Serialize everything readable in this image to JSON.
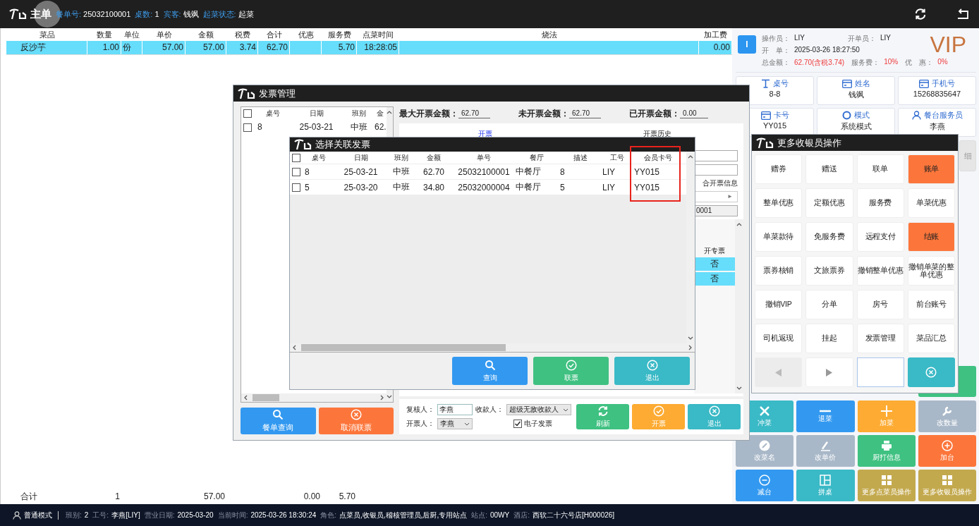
{
  "topbar": {
    "title": "主单",
    "fields": [
      {
        "label": "餐单号:",
        "value": "25032100001"
      },
      {
        "label": "桌数:",
        "value": "1"
      },
      {
        "label": "宾客:",
        "value": "钱飒"
      },
      {
        "label": "起菜状态:",
        "value": "起菜"
      }
    ]
  },
  "order_table": {
    "columns": [
      "菜品",
      "数量",
      "单位",
      "单价",
      "金额",
      "税费",
      "合计",
      "优惠",
      "服务费",
      "点菜时间",
      "烧法",
      "加工费"
    ],
    "rows": [
      {
        "selected": true,
        "cells": [
          "反沙芋",
          "1.00",
          "份",
          "57.00",
          "57.00",
          "3.74",
          "62.70",
          "",
          "5.70",
          "18:28:05",
          "",
          "0.00"
        ]
      }
    ],
    "totals": {
      "label": "合计",
      "quantity": "1",
      "amount": "57.00",
      "discount": "0.00",
      "service_fee": "5.70"
    }
  },
  "operator_info": {
    "badge": "I",
    "rows": [
      [
        {
          "label": "操作员：",
          "value": "LIY",
          "kind": "plain"
        },
        {
          "label": "开单员：",
          "value": "LIY",
          "kind": "plain"
        }
      ],
      [
        {
          "label": "开　单：",
          "value": "2025-03-26 18:27:50",
          "kind": "plain"
        }
      ],
      [
        {
          "label": "总金额：",
          "value": "62.70(含税3.74)",
          "kind": "alert"
        },
        {
          "label": "服务费：",
          "value": "10%",
          "kind": "alert"
        },
        {
          "label": "优　惠：",
          "value": "0%",
          "kind": "alert"
        }
      ]
    ],
    "vip": "VIP"
  },
  "info_cards": [
    {
      "kind": "table",
      "label": "桌号",
      "value": "8-8"
    },
    {
      "kind": "card",
      "label": "姓名",
      "value": "钱飒"
    },
    {
      "kind": "card",
      "label": "手机号",
      "value": "15268835647"
    },
    {
      "kind": "card",
      "label": "卡号",
      "value": "YY015"
    },
    {
      "kind": "ring",
      "label": "模式",
      "value": "系统模式"
    },
    {
      "kind": "person",
      "label": "餐台服务员",
      "value": "李燕"
    }
  ],
  "detail_button": {
    "label": "细"
  },
  "action_buttons": [
    {
      "label": "冲菜",
      "kind": "cross",
      "color": "#3ab9c6"
    },
    {
      "label": "退菜",
      "kind": "minus",
      "color": "#3399f0"
    },
    {
      "label": "加菜",
      "kind": "plus",
      "color": "#fdab32"
    },
    {
      "label": "改数量",
      "kind": "wrench",
      "color": "#a9b8c8"
    },
    {
      "label": "改菜名",
      "kind": "pencil",
      "color": "#a9b8c8"
    },
    {
      "label": "改单价",
      "kind": "pen",
      "color": "#a9b8c8"
    },
    {
      "label": "厨打信息",
      "kind": "printer",
      "color": "#3fc181"
    },
    {
      "label": "加台",
      "kind": "plus-circle",
      "color": "#fc763b"
    },
    {
      "label": "减台",
      "kind": "minus-circle",
      "color": "#3399f0"
    },
    {
      "label": "拼桌",
      "kind": "layout",
      "color": "#3ab9c6"
    },
    {
      "label": "更多点菜员操作",
      "kind": "grid",
      "color": "#c3a94e"
    },
    {
      "label": "更多收银员操作",
      "kind": "grid",
      "color": "#c3a94e"
    }
  ],
  "invoice_dialog": {
    "title": "发票管理",
    "bill_list": {
      "header_checked": false,
      "columns": [
        "桌号",
        "日期",
        "班别",
        "金"
      ],
      "rows": [
        {
          "checked": false,
          "cells": [
            "8",
            "25-03-21",
            "中班",
            "62."
          ]
        }
      ]
    },
    "buttons": [
      {
        "label": "餐单查询",
        "kind": "search",
        "color": "#3399f0"
      },
      {
        "label": "取消联票",
        "kind": "cancel",
        "color": "#fc763b"
      }
    ],
    "amounts": [
      {
        "label": "最大开票金额：",
        "value": "62.70"
      },
      {
        "label": "未开票金额：",
        "value": "62.70"
      },
      {
        "label": "已开票金额：",
        "value": "0.00"
      }
    ],
    "tabs": [
      {
        "label": "开票",
        "selected": true
      },
      {
        "label": "开票历史",
        "selected": false
      }
    ],
    "info_label": "合开票信息",
    "dropdown_arrow": "►",
    "code_value": "0001",
    "special_table": {
      "column": "开专票",
      "rows": [
        "否",
        "否"
      ]
    },
    "form": {
      "reviewer": {
        "label": "复核人：",
        "value": "李燕"
      },
      "payee": {
        "label": "收款人：",
        "value": "超级无敌收款人"
      },
      "issuer": {
        "label": "开票人：",
        "value": "李燕"
      },
      "e_invoice": {
        "label": "电子发票",
        "checked": true
      }
    },
    "actions": [
      {
        "label": "刷新",
        "kind": "refresh",
        "color": "#3fc181"
      },
      {
        "label": "开票",
        "kind": "check",
        "color": "#fdab32"
      },
      {
        "label": "退出",
        "kind": "cancel",
        "color": "#3ab9c6"
      }
    ]
  },
  "link_dialog": {
    "title": "选择关联发票",
    "header_checked": false,
    "columns": [
      {
        "label": "桌号",
        "highlighted": false
      },
      {
        "label": "日期",
        "highlighted": false
      },
      {
        "label": "班别",
        "highlighted": false
      },
      {
        "label": "金额",
        "highlighted": false
      },
      {
        "label": "单号",
        "highlighted": false
      },
      {
        "label": "餐厅",
        "highlighted": false
      },
      {
        "label": "描述",
        "highlighted": false
      },
      {
        "label": "工号",
        "highlighted": false
      },
      {
        "label": "会员卡号",
        "highlighted": true
      }
    ],
    "rows": [
      {
        "checked": false,
        "cells": [
          "8",
          "25-03-21",
          "中班",
          "62.70",
          "25032100001",
          "中餐厅",
          "8",
          "LIY",
          "YY015"
        ]
      },
      {
        "checked": false,
        "cells": [
          "5",
          "25-03-20",
          "中班",
          "34.80",
          "25032000004",
          "中餐厅",
          "5",
          "LIY",
          "YY015"
        ]
      }
    ],
    "buttons": [
      {
        "label": "查询",
        "kind": "search",
        "color": "#3399f0"
      },
      {
        "label": "联票",
        "kind": "check",
        "color": "#3fc181"
      },
      {
        "label": "退出",
        "kind": "cancel",
        "color": "#3ab9c6"
      }
    ]
  },
  "cashier_dialog": {
    "title": "更多收银员操作",
    "buttons": [
      {
        "label": "赠券",
        "kind": "normal"
      },
      {
        "label": "赠送",
        "kind": "normal"
      },
      {
        "label": "联单",
        "kind": "normal"
      },
      {
        "label": "账单",
        "kind": "accent"
      },
      {
        "label": "整单优惠",
        "kind": "normal"
      },
      {
        "label": "定额优惠",
        "kind": "normal"
      },
      {
        "label": "服务费",
        "kind": "normal"
      },
      {
        "label": "单菜优惠",
        "kind": "normal"
      },
      {
        "label": "单菜款待",
        "kind": "normal"
      },
      {
        "label": "免服务费",
        "kind": "normal"
      },
      {
        "label": "远程支付",
        "kind": "normal"
      },
      {
        "label": "结账",
        "kind": "accent"
      },
      {
        "label": "票券核销",
        "kind": "normal"
      },
      {
        "label": "文旅票券",
        "kind": "normal"
      },
      {
        "label": "撤销整单优惠",
        "kind": "normal"
      },
      {
        "label": "撤销单菜的整单优惠",
        "kind": "normal"
      },
      {
        "label": "撤销VIP",
        "kind": "normal"
      },
      {
        "label": "分单",
        "kind": "normal"
      },
      {
        "label": "房号",
        "kind": "normal"
      },
      {
        "label": "前台账号",
        "kind": "normal"
      },
      {
        "label": "司机返现",
        "kind": "normal"
      },
      {
        "label": "挂起",
        "kind": "normal"
      },
      {
        "label": "发票管理",
        "kind": "normal"
      },
      {
        "label": "菜品汇总",
        "kind": "normal"
      }
    ],
    "pager": {
      "prev_disabled": true,
      "next_disabled": false
    }
  },
  "status_bar": {
    "mode": "普通模式",
    "fields": [
      {
        "label": "班别:",
        "value": "2"
      },
      {
        "label": "工号:",
        "value": "李燕[LIY]"
      },
      {
        "label": "营业日期:",
        "value": "2025-03-20"
      },
      {
        "label": "当前时间:",
        "value": "2025-03-26 18:30:24"
      },
      {
        "label": "角色:",
        "value": "点菜员,收银员,稽核管理员,后厨,专用站点"
      },
      {
        "label": "站点:",
        "value": "00WY"
      },
      {
        "label": "酒店:",
        "value": "西软二十六号店[H000026]"
      }
    ]
  }
}
